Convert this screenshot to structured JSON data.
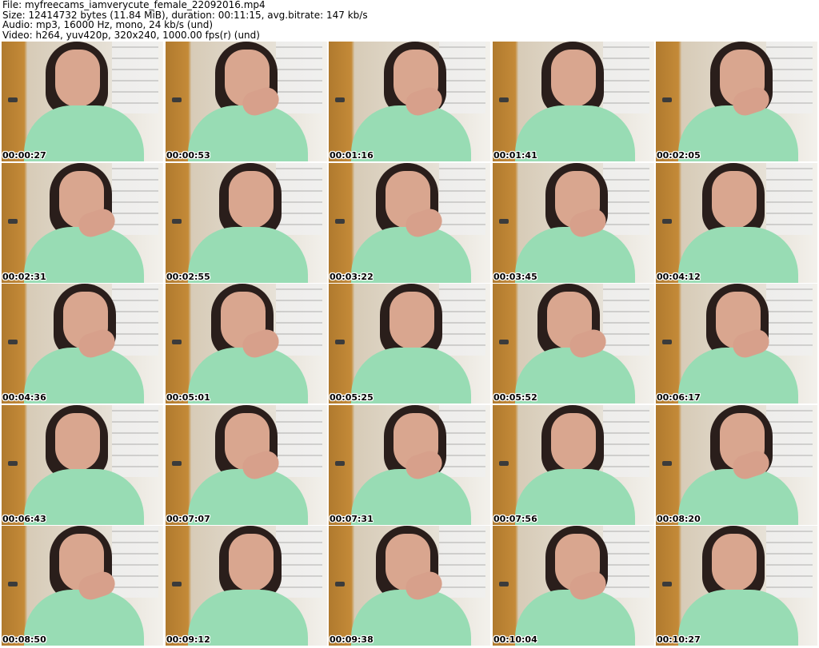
{
  "header": {
    "file": "File: myfreecams_iamverycute_female_22092016.mp4",
    "size": "Size: 12414732 bytes (11.84 MiB), duration: 00:11:15, avg.bitrate: 147 kb/s",
    "audio": "Audio: mp3, 16000 Hz, mono, 24 kb/s (und)",
    "video": "Video: h264, yuv420p, 320x240, 1000.00 fps(r) (und)"
  },
  "thumbnails": [
    {
      "time": "00:00:27"
    },
    {
      "time": "00:00:53"
    },
    {
      "time": "00:01:16"
    },
    {
      "time": "00:01:41"
    },
    {
      "time": "00:02:05"
    },
    {
      "time": "00:02:31"
    },
    {
      "time": "00:02:55"
    },
    {
      "time": "00:03:22"
    },
    {
      "time": "00:03:45"
    },
    {
      "time": "00:04:12"
    },
    {
      "time": "00:04:36"
    },
    {
      "time": "00:05:01"
    },
    {
      "time": "00:05:25"
    },
    {
      "time": "00:05:52"
    },
    {
      "time": "00:06:17"
    },
    {
      "time": "00:06:43"
    },
    {
      "time": "00:07:07"
    },
    {
      "time": "00:07:31"
    },
    {
      "time": "00:07:56"
    },
    {
      "time": "00:08:20"
    },
    {
      "time": "00:08:50"
    },
    {
      "time": "00:09:12"
    },
    {
      "time": "00:09:38"
    },
    {
      "time": "00:10:04"
    },
    {
      "time": "00:10:27"
    }
  ]
}
